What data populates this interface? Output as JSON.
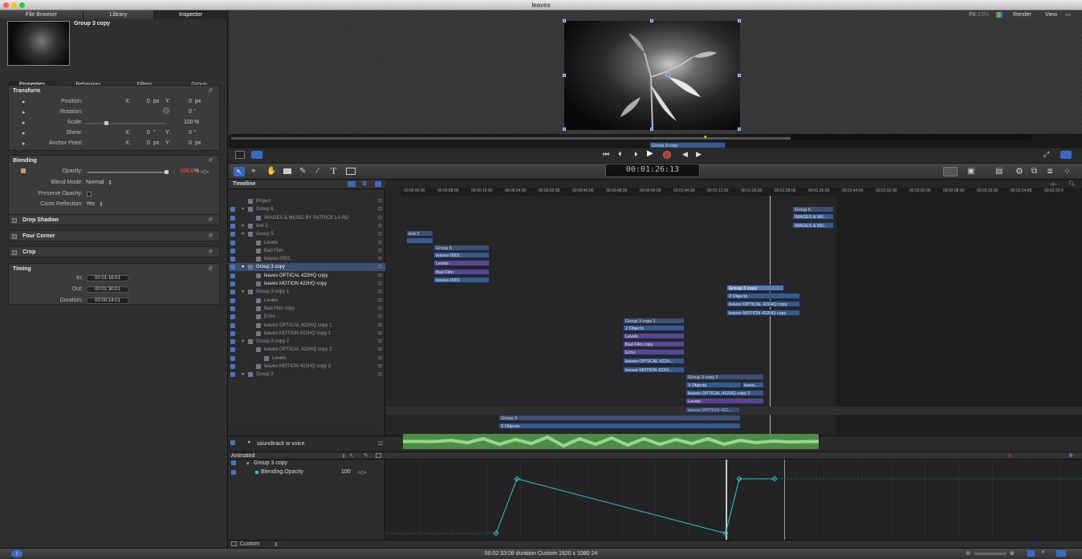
{
  "window": {
    "title": "leaves"
  },
  "topbar": {
    "fit": "Fit:",
    "fit_value": "23%",
    "render": "Render",
    "view": "View"
  },
  "panel_tabs": [
    "File Browser",
    "Library",
    "Inspector"
  ],
  "inspector": {
    "selection_name": "Group 3 copy",
    "tabs": [
      "Properties",
      "Behaviors",
      "Filters",
      "Group"
    ],
    "transform": {
      "label": "Transform",
      "position": {
        "label": "Position:",
        "x": "0",
        "y": "0",
        "unit": "px"
      },
      "rotation": {
        "label": "Rotation:",
        "value": "0",
        "unit": "°"
      },
      "scale": {
        "label": "Scale:",
        "value": "100",
        "unit": "%"
      },
      "shear": {
        "label": "Shear:",
        "x": "0",
        "y": "0",
        "unit": "°"
      },
      "anchor": {
        "label": "Anchor Point:",
        "x": "0",
        "y": "0",
        "unit": "px"
      },
      "x_label": "X:",
      "y_label": "Y:"
    },
    "blending": {
      "label": "Blending",
      "opacity": {
        "label": "Opacity:",
        "value": "100.0",
        "unit": "%"
      },
      "blend_mode": {
        "label": "Blend Mode:",
        "value": "Normal"
      },
      "preserve_opacity": {
        "label": "Preserve Opacity:"
      },
      "casts_reflection": {
        "label": "Casts Reflection:",
        "value": "Yes"
      }
    },
    "drop_shadow": "Drop Shadow",
    "four_corner": "Four Corner",
    "crop": "Crop",
    "timing": {
      "label": "Timing",
      "in": {
        "label": "In:",
        "value": "00:01:16:01"
      },
      "out": {
        "label": "Out:",
        "value": "00:01:30:01"
      },
      "duration": {
        "label": "Duration:",
        "value": "00:00:14:01"
      }
    }
  },
  "canvas": {
    "mini_clip": "Group 3 copy"
  },
  "timecode": "00:01:26:13",
  "timeline": {
    "label": "Timeline",
    "ruler": [
      "00:00:00:00",
      "00:00:08:00",
      "00:00:16:00",
      "00:00:24:00",
      "00:00:32:00",
      "00:00:40:00",
      "00:00:48:00",
      "00:00:56:00",
      "00:01:04:00",
      "00:01:12:00",
      "00:01:20:00",
      "00:01:28:00",
      "00:01:36:00",
      "00:01:44:00",
      "00:01:52:00",
      "00:02:00:00",
      "00:02:08:00",
      "00:02:16:00",
      "00:02:24:00",
      "00:02:32:0"
    ],
    "layers": [
      {
        "name": "Project",
        "indent": 0,
        "style": "dim"
      },
      {
        "name": "Group 6",
        "indent": 0,
        "style": "dim"
      },
      {
        "name": "IMAGES & MUSIC BY PATRICK LA RO",
        "indent": 1,
        "style": "dim"
      },
      {
        "name": "text 2",
        "indent": 0,
        "style": "dim"
      },
      {
        "name": "Group 5",
        "indent": 0,
        "style": "dim"
      },
      {
        "name": "Levels",
        "indent": 1,
        "style": "dim"
      },
      {
        "name": "Bad Film",
        "indent": 1,
        "style": "dim"
      },
      {
        "name": "leaves-0001",
        "indent": 1,
        "style": "dim"
      },
      {
        "name": "Group 3 copy",
        "indent": 0,
        "style": "sel"
      },
      {
        "name": "leaves OPTICAL 422HQ copy",
        "indent": 1,
        "style": "bright"
      },
      {
        "name": "leaves MOTION 422HQ copy",
        "indent": 1,
        "style": "bright"
      },
      {
        "name": "Group 3 copy 1",
        "indent": 0,
        "style": "dim"
      },
      {
        "name": "Levels",
        "indent": 1,
        "style": "dim"
      },
      {
        "name": "Bad Film copy",
        "indent": 1,
        "style": "dim"
      },
      {
        "name": "Echo",
        "indent": 1,
        "style": "dim"
      },
      {
        "name": "leaves OPTICAL 422HQ copy 1",
        "indent": 1,
        "style": "dim"
      },
      {
        "name": "leaves MOTION 422HQ copy 1",
        "indent": 1,
        "style": "dim"
      },
      {
        "name": "Group 3 copy 2",
        "indent": 0,
        "style": "dim"
      },
      {
        "name": "leaves OPTICAL 422HQ copy 2",
        "indent": 1,
        "style": "dim"
      },
      {
        "name": "Levels",
        "indent": 2,
        "style": "dim"
      },
      {
        "name": "leaves MOTION 422HQ copy 2",
        "indent": 1,
        "style": "dim"
      },
      {
        "name": "Group 3",
        "indent": 0,
        "style": "dim"
      }
    ],
    "audio_track": "soundtrack w voice",
    "clips": {
      "group6": "Group 6",
      "images1": "IMAGES & MU...",
      "images2": "IMAGES & MU...",
      "text2": "text 2",
      "g5": "Group 5",
      "leaves0001a": "leaves-0001",
      "levels": "Levels",
      "badfilm": "Bad Film",
      "leaves0001b": "leaves-0001",
      "g3c": "Group 3 copy",
      "obj2": "2 Objects",
      "opt": "leaves OPTICAL 422HQ copy",
      "mot": "leaves MOTION 422HQ copy",
      "g3c1": "Group 3 copy 1",
      "obj2b": "2 Objects",
      "lev1": "Levels",
      "bfc": "Bad Film copy",
      "echo": "Echo",
      "opt1": "leaves OPTICAL 422H...",
      "mot1": "leaves MOTION 422H...",
      "g3c2": "Group 3 copy 2",
      "obj3": "3 Objects",
      "leave": "leave...",
      "opt2": "leaves OPTICAL 422HQ copy 2",
      "lev2": "Levels",
      "mot2": "leaves MOTION 422...",
      "g3": "Group 3",
      "obj3b": "3 Objects"
    }
  },
  "keyframes": {
    "filter": "Animated",
    "group": "Group 3 copy",
    "param": "Blending.Opacity",
    "value": "100",
    "bottom_menu": "Custom"
  },
  "status": "00:02:33:08 duration Custom 1920 x 1080 24"
}
